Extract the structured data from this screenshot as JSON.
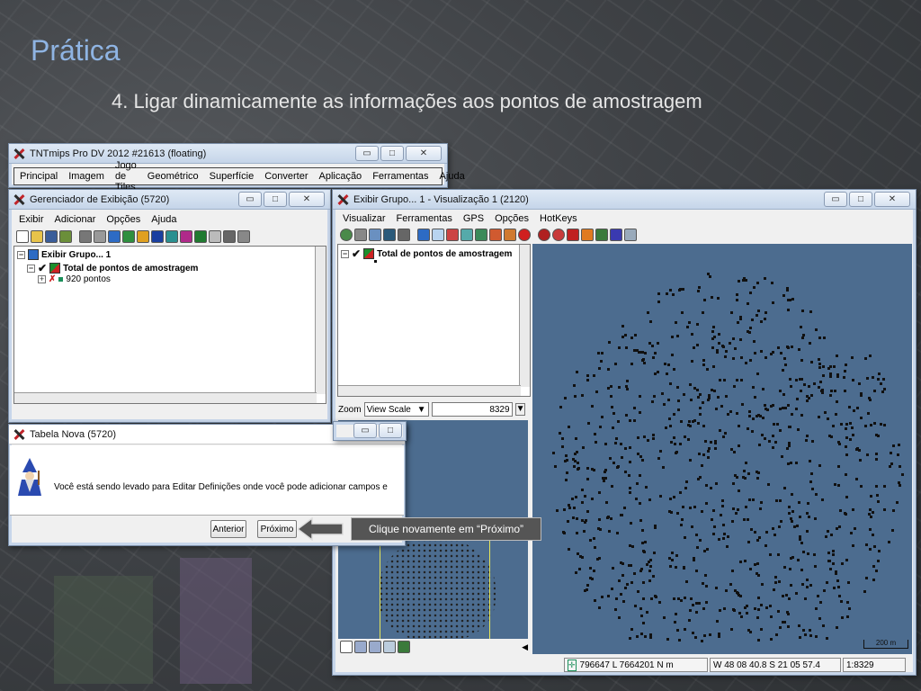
{
  "slide": {
    "title": "Prática",
    "subtitle": "4. Ligar dinamicamente as informações aos pontos de amostragem"
  },
  "main_window": {
    "title": "TNTmips Pro DV 2012  #21613 (floating)",
    "menu": [
      "Principal",
      "Imagem",
      "Jogo de Tiles",
      "Geométrico",
      "Superfície",
      "Converter",
      "Aplicação",
      "Ferramentas",
      "Ajuda"
    ]
  },
  "display_manager": {
    "title": "Gerenciador de Exibição (5720)",
    "menu": [
      "Exibir",
      "Adicionar",
      "Opções",
      "Ajuda"
    ],
    "tree": {
      "group": "Exibir Grupo... 1",
      "layer": "Total de pontos de amostragem",
      "points": "920 pontos"
    }
  },
  "view_window": {
    "title": "Exibir Grupo... 1 - Visualização 1 (2120)",
    "menu": [
      "Visualizar",
      "Ferramentas",
      "GPS",
      "Opções",
      "HotKeys"
    ],
    "layer_label": "Total de pontos de amostragem",
    "zoom_label": "Zoom",
    "zoom_mode": "View Scale",
    "zoom_value": "8329",
    "status": {
      "coords": "796647 L  7664201 N m",
      "latlon": "W 48 08 40.8  S 21 05 57.4",
      "scale": "1:8329"
    },
    "scale_bar": "200 m"
  },
  "new_table_dialog": {
    "title": "Tabela Nova (5720)",
    "message": "Você está sendo levado para  Editar Definições onde você pode adicionar campos e",
    "back_label": "Anterior",
    "next_label": "Próximo"
  },
  "callout": {
    "text": "Clique novamente em “Próximo”"
  },
  "colors": {
    "title_blue": "#8fb4e3",
    "map_background": "#4c6c8f",
    "window_frame": "#c7d6ea"
  }
}
